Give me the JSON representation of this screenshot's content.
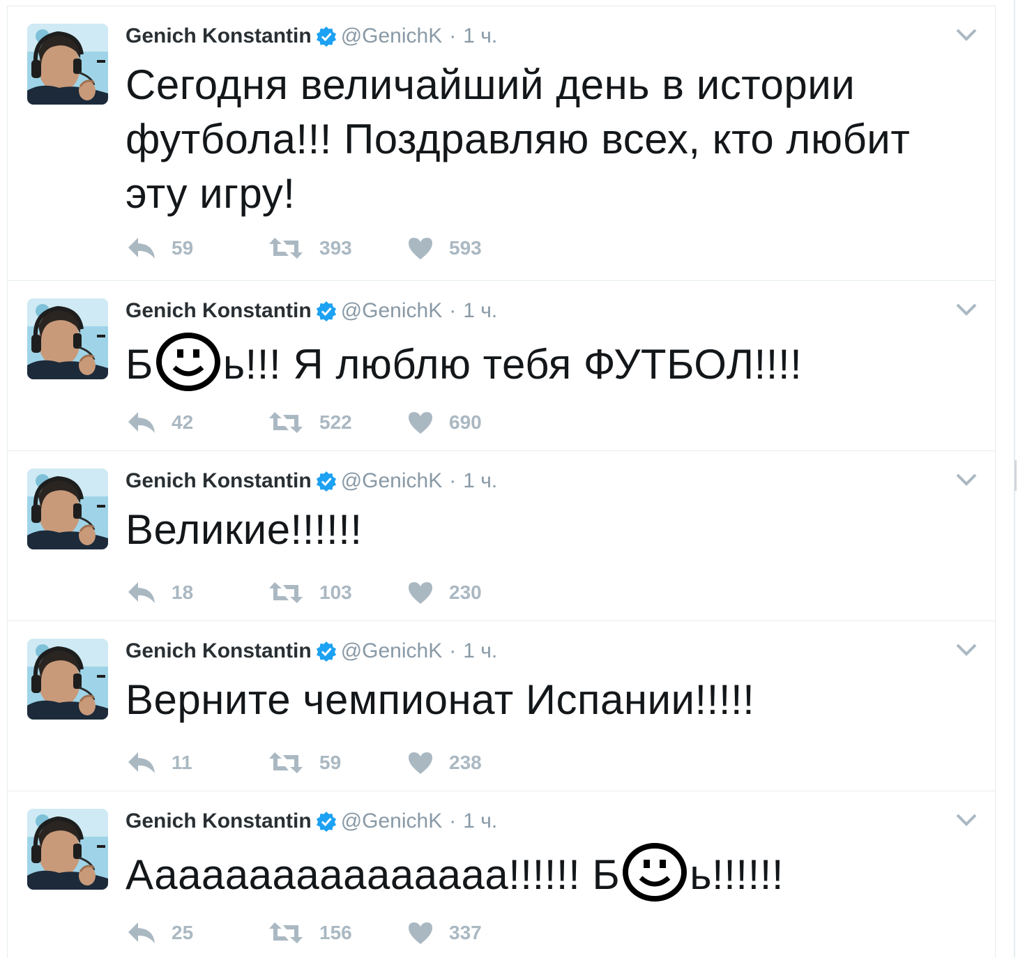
{
  "tweets": [
    {
      "name": "Genich Konstantin",
      "handle": "@GenichK",
      "separator": "·",
      "time": "1 ч.",
      "text_parts": [
        "Сегодня величайший день в истории футбола!!! Поздравляю всех, кто любит эту игру!"
      ],
      "replies": "59",
      "retweets": "393",
      "likes": "593"
    },
    {
      "name": "Genich Konstantin",
      "handle": "@GenichK",
      "separator": "·",
      "time": "1 ч.",
      "text_parts": [
        "Б",
        "ь!!! Я люблю тебя ФУТБОЛ!!!!"
      ],
      "replies": "42",
      "retweets": "522",
      "likes": "690"
    },
    {
      "name": "Genich Konstantin",
      "handle": "@GenichK",
      "separator": "·",
      "time": "1 ч.",
      "text_parts": [
        "Великие!!!!!!"
      ],
      "replies": "18",
      "retweets": "103",
      "likes": "230"
    },
    {
      "name": "Genich Konstantin",
      "handle": "@GenichK",
      "separator": "·",
      "time": "1 ч.",
      "text_parts": [
        "Верните чемпионат Испании!!!!!"
      ],
      "replies": "11",
      "retweets": "59",
      "likes": "238"
    },
    {
      "name": "Genich Konstantin",
      "handle": "@GenichK",
      "separator": "·",
      "time": "1 ч.",
      "text_parts": [
        "Аааааааааааааааа!!!!!! Б",
        "ь!!!!!!"
      ],
      "replies": "25",
      "retweets": "156",
      "likes": "337"
    }
  ],
  "colors": {
    "verified": "#1da1f2",
    "text": "#14171a",
    "muted": "#8899a6",
    "action": "#aab8c2",
    "border": "#e6ecf0"
  },
  "icons": [
    "avatar",
    "verified-badge-icon",
    "chevron-down-icon",
    "reply-icon",
    "retweet-icon",
    "heart-icon",
    "smiley-face-icon"
  ]
}
